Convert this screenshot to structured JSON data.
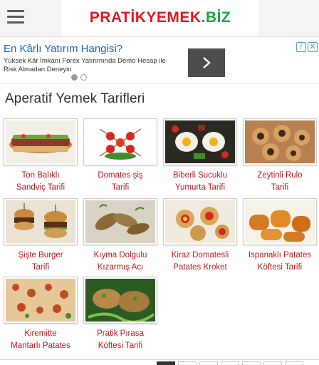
{
  "header": {
    "menu_icon": "hamburger-menu-icon",
    "logo_part1": "PRATİKYEMEK",
    "logo_part2": ".BİZ",
    "logo_colors": {
      "red": "#e2171d",
      "green": "#1aa53b"
    }
  },
  "ad": {
    "title": "En Kârlı Yatırım Hangisi?",
    "description": "Yüksek Kâr İmkanı Forex Yatırımında Demo Hesap ile Risk Almadan Deneyin",
    "arrow_icon": "chevron-right-icon",
    "info_icon": "info-icon",
    "close_icon": "close-icon",
    "carousel_dots": 2,
    "active_dot": 1
  },
  "section": {
    "title": "Aperatif Yemek Tarifleri"
  },
  "recipes": [
    {
      "line1": "Ton Balıklı",
      "line2": "Sandviç Tarifi"
    },
    {
      "line1": "Domates şiş",
      "line2": "Tarifi"
    },
    {
      "line1": "Biberli Sucuklu",
      "line2": "Yumurta Tarifi"
    },
    {
      "line1": "Zeytinli Rulo",
      "line2": "Tarifi"
    },
    {
      "line1": "Şişte Burger",
      "line2": "Tarifi"
    },
    {
      "line1": "Kıyma Dolgulu",
      "line2": "Kızarmış Acı"
    },
    {
      "line1": "Kiraz Domatesli",
      "line2": "Patates Kroket"
    },
    {
      "line1": "Ispanaklı Patates",
      "line2": "Köftesi Tarifi"
    },
    {
      "line1": "Kiremitte",
      "line2": "Mantarlı Patates"
    },
    {
      "line1": "Pratik Pırasa",
      "line2": "Köftesi Tarifi"
    }
  ],
  "accent_color": "#c0171d"
}
